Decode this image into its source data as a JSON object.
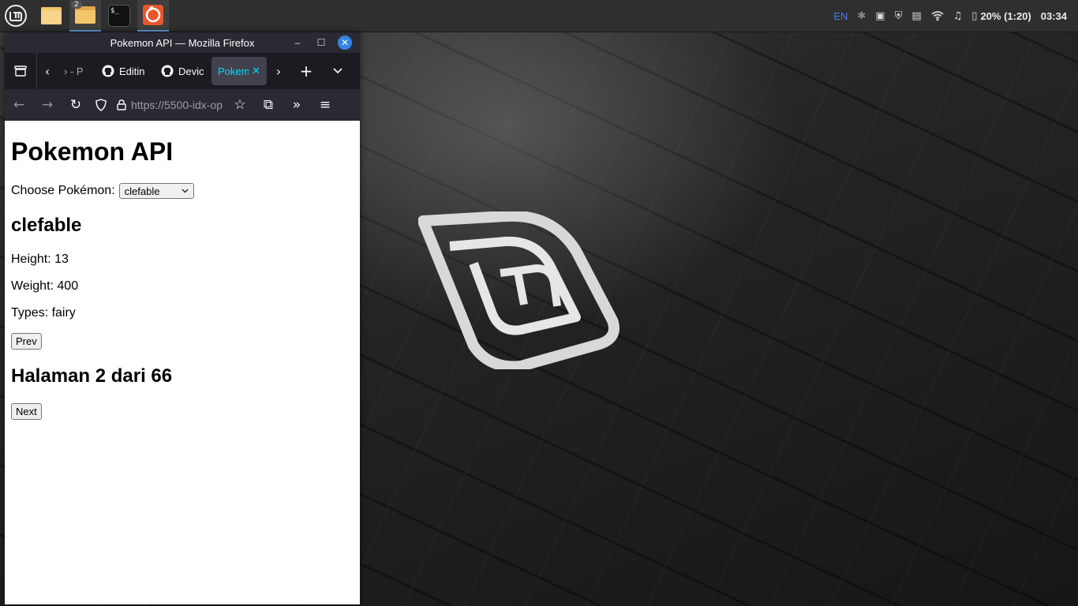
{
  "taskbar": {
    "files_badge": "2",
    "terminal_label": "$_"
  },
  "tray": {
    "language": "EN",
    "battery": "20% (1:20)",
    "clock": "03:34"
  },
  "window": {
    "title": "Pokemon API — Mozilla Firefox"
  },
  "tabs": [
    {
      "label": "› - P"
    },
    {
      "label": "Editin"
    },
    {
      "label": "Devic"
    },
    {
      "label": "Pokem"
    }
  ],
  "navbar": {
    "url": "https://5500-idx-op"
  },
  "page": {
    "heading": "Pokemon API",
    "choose_label": "Choose Pokémon:",
    "selected": "clefable",
    "name": "clefable",
    "height": "Height: 13",
    "weight": "Weight: 400",
    "types": "Types: fairy",
    "prev_label": "Prev",
    "pagination": "Halaman 2 dari 66",
    "next_label": "Next"
  },
  "colors": {
    "accent": "#3584e4",
    "active_tab": "#00ddff"
  }
}
